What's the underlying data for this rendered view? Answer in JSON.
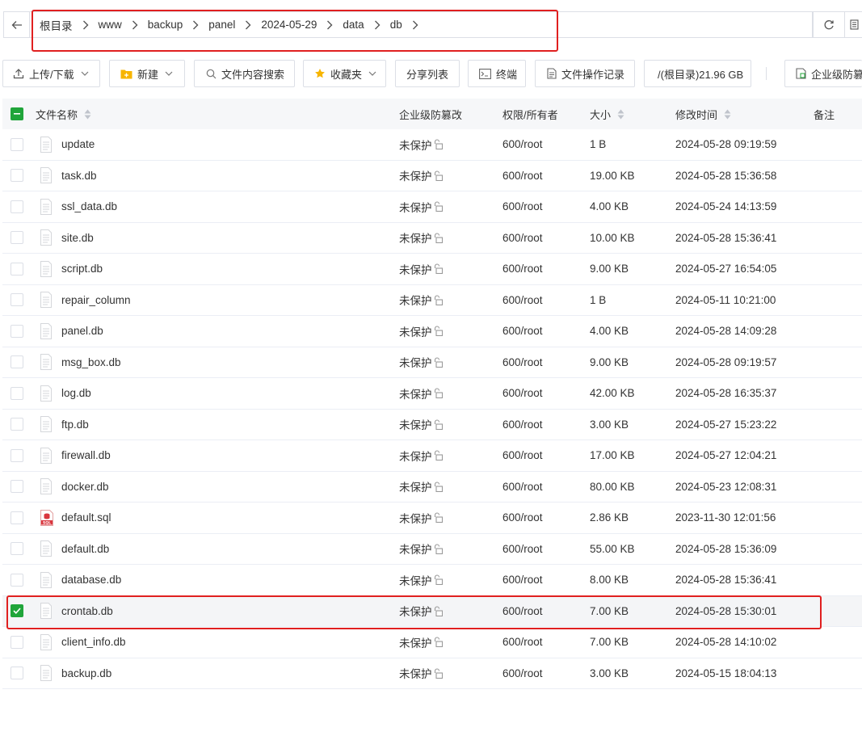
{
  "breadcrumb": [
    "根目录",
    "www",
    "backup",
    "panel",
    "2024-05-29",
    "data",
    "db"
  ],
  "toolbar": {
    "upload": "上传/下载",
    "new": "新建",
    "search": "文件内容搜索",
    "favorites": "收藏夹",
    "share": "分享列表",
    "terminal": "终端",
    "oplog": "文件操作记录",
    "disk": "/(根目录)21.96 GB",
    "tamper": "企业级防篡改"
  },
  "columns": {
    "name": "文件名称",
    "protect": "企业级防篡改",
    "perm": "权限/所有者",
    "size": "大小",
    "mtime": "修改时间",
    "note": "备注"
  },
  "files": [
    {
      "name": "update",
      "icon": "file-icon",
      "protect": "未保护",
      "perm": "600/root",
      "size": "1 B",
      "mtime": "2024-05-28 09:19:59",
      "checked": false
    },
    {
      "name": "task.db",
      "icon": "file-icon",
      "protect": "未保护",
      "perm": "600/root",
      "size": "19.00 KB",
      "mtime": "2024-05-28 15:36:58",
      "checked": false
    },
    {
      "name": "ssl_data.db",
      "icon": "file-icon",
      "protect": "未保护",
      "perm": "600/root",
      "size": "4.00 KB",
      "mtime": "2024-05-24 14:13:59",
      "checked": false
    },
    {
      "name": "site.db",
      "icon": "file-icon",
      "protect": "未保护",
      "perm": "600/root",
      "size": "10.00 KB",
      "mtime": "2024-05-28 15:36:41",
      "checked": false
    },
    {
      "name": "script.db",
      "icon": "file-icon",
      "protect": "未保护",
      "perm": "600/root",
      "size": "9.00 KB",
      "mtime": "2024-05-27 16:54:05",
      "checked": false
    },
    {
      "name": "repair_column",
      "icon": "file-icon",
      "protect": "未保护",
      "perm": "600/root",
      "size": "1 B",
      "mtime": "2024-05-11 10:21:00",
      "checked": false
    },
    {
      "name": "panel.db",
      "icon": "file-icon",
      "protect": "未保护",
      "perm": "600/root",
      "size": "4.00 KB",
      "mtime": "2024-05-28 14:09:28",
      "checked": false
    },
    {
      "name": "msg_box.db",
      "icon": "file-icon",
      "protect": "未保护",
      "perm": "600/root",
      "size": "9.00 KB",
      "mtime": "2024-05-28 09:19:57",
      "checked": false
    },
    {
      "name": "log.db",
      "icon": "file-icon",
      "protect": "未保护",
      "perm": "600/root",
      "size": "42.00 KB",
      "mtime": "2024-05-28 16:35:37",
      "checked": false
    },
    {
      "name": "ftp.db",
      "icon": "file-icon",
      "protect": "未保护",
      "perm": "600/root",
      "size": "3.00 KB",
      "mtime": "2024-05-27 15:23:22",
      "checked": false
    },
    {
      "name": "firewall.db",
      "icon": "file-icon",
      "protect": "未保护",
      "perm": "600/root",
      "size": "17.00 KB",
      "mtime": "2024-05-27 12:04:21",
      "checked": false
    },
    {
      "name": "docker.db",
      "icon": "file-icon",
      "protect": "未保护",
      "perm": "600/root",
      "size": "80.00 KB",
      "mtime": "2024-05-23 12:08:31",
      "checked": false
    },
    {
      "name": "default.sql",
      "icon": "sql-file-icon",
      "protect": "未保护",
      "perm": "600/root",
      "size": "2.86 KB",
      "mtime": "2023-11-30 12:01:56",
      "checked": false
    },
    {
      "name": "default.db",
      "icon": "file-icon",
      "protect": "未保护",
      "perm": "600/root",
      "size": "55.00 KB",
      "mtime": "2024-05-28 15:36:09",
      "checked": false
    },
    {
      "name": "database.db",
      "icon": "file-icon",
      "protect": "未保护",
      "perm": "600/root",
      "size": "8.00 KB",
      "mtime": "2024-05-28 15:36:41",
      "checked": false
    },
    {
      "name": "crontab.db",
      "icon": "file-icon",
      "protect": "未保护",
      "perm": "600/root",
      "size": "7.00 KB",
      "mtime": "2024-05-28 15:30:01",
      "checked": true
    },
    {
      "name": "client_info.db",
      "icon": "file-icon",
      "protect": "未保护",
      "perm": "600/root",
      "size": "7.00 KB",
      "mtime": "2024-05-28 14:10:02",
      "checked": false
    },
    {
      "name": "backup.db",
      "icon": "file-icon",
      "protect": "未保护",
      "perm": "600/root",
      "size": "3.00 KB",
      "mtime": "2024-05-15 18:04:13",
      "checked": false
    }
  ],
  "colors": {
    "accent": "#20a53a",
    "highlight": "#e02020"
  }
}
